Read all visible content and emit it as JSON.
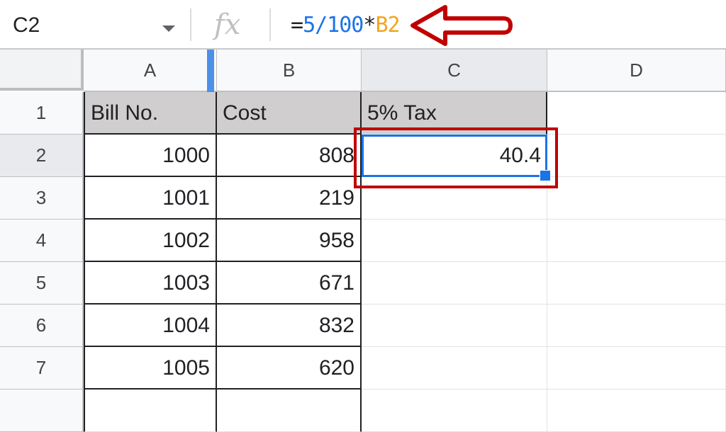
{
  "formula_bar": {
    "name_box": "C2",
    "fx_label": "fx",
    "formula_eq": "=",
    "formula_num": "5/100",
    "formula_op": "*",
    "formula_ref": "B2"
  },
  "columns": [
    "A",
    "B",
    "C",
    "D"
  ],
  "rows": [
    "1",
    "2",
    "3",
    "4",
    "5",
    "6",
    "7"
  ],
  "table": {
    "headers": [
      "Bill No.",
      "Cost",
      "5% Tax"
    ],
    "bill_no": [
      "1000",
      "1001",
      "1002",
      "1003",
      "1004",
      "1005"
    ],
    "cost": [
      "808",
      "219",
      "958",
      "671",
      "832",
      "620"
    ],
    "tax": [
      "40.4"
    ]
  },
  "colors": {
    "accent": "#1a73e8",
    "annotation": "#c00000",
    "reference": "#f4a51c",
    "header_fill": "#d0cece"
  }
}
